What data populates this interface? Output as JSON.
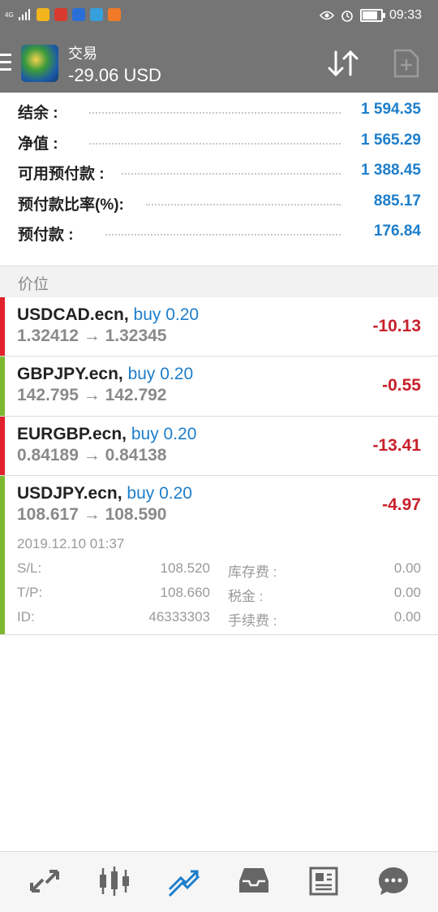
{
  "status_bar": {
    "network": "4G",
    "time": "09:33",
    "app_icon_colors": [
      "#f2b51d",
      "#d83b2d",
      "#2a6ed8",
      "#37a0dc",
      "#f07a28"
    ]
  },
  "header": {
    "title": "交易",
    "balance_display": "-29.06 USD",
    "icons": [
      "menu-icon",
      "app-logo",
      "sort-icon",
      "new-order-icon"
    ]
  },
  "summary": [
    {
      "label": "结余 :",
      "value": "1 594.35"
    },
    {
      "label": "净值 :",
      "value": "1 565.29"
    },
    {
      "label": "可用预付款 :",
      "value": "1 388.45"
    },
    {
      "label": "预付款比率(%):",
      "value": "885.17"
    },
    {
      "label": "预付款 :",
      "value": "176.84"
    }
  ],
  "section_title": "价位",
  "positions": [
    {
      "symbol": "USDCAD.ecn,",
      "side": "buy 0.20",
      "prices": "1.32412 → 1.32345",
      "profit": "-10.13",
      "bar_color": "#e0202a"
    },
    {
      "symbol": "GBPJPY.ecn,",
      "side": "buy 0.20",
      "prices": "142.795 → 142.792",
      "profit": "-0.55",
      "bar_color": "#7cb82f"
    },
    {
      "symbol": "EURGBP.ecn,",
      "side": "buy 0.20",
      "prices": "0.84189 → 0.84138",
      "profit": "-13.41",
      "bar_color": "#e0202a"
    },
    {
      "symbol": "USDJPY.ecn,",
      "side": "buy 0.20",
      "prices": "108.617 → 108.590",
      "profit": "-4.97",
      "bar_color": "#7cb82f"
    }
  ],
  "details": {
    "date": "2019.12.10 01:37",
    "rows": [
      {
        "k1": "S/L:",
        "v1": "108.520",
        "k2": "库存费 :",
        "v2": "0.00"
      },
      {
        "k1": "T/P:",
        "v1": "108.660",
        "k2": "税金 :",
        "v2": "0.00"
      },
      {
        "k1": "ID:",
        "v1": "46333303",
        "k2": "手续费 :",
        "v2": "0.00"
      }
    ]
  },
  "nav": [
    {
      "name": "quotes-icon",
      "active": false
    },
    {
      "name": "chart-icon",
      "active": false
    },
    {
      "name": "trade-icon",
      "active": true
    },
    {
      "name": "history-icon",
      "active": false
    },
    {
      "name": "news-icon",
      "active": false
    },
    {
      "name": "chat-icon",
      "active": false
    }
  ],
  "colors": {
    "accent": "#1d7ecb",
    "loss": "#c8202a",
    "toolbar": "#757575",
    "nav_icon": "#666666"
  }
}
